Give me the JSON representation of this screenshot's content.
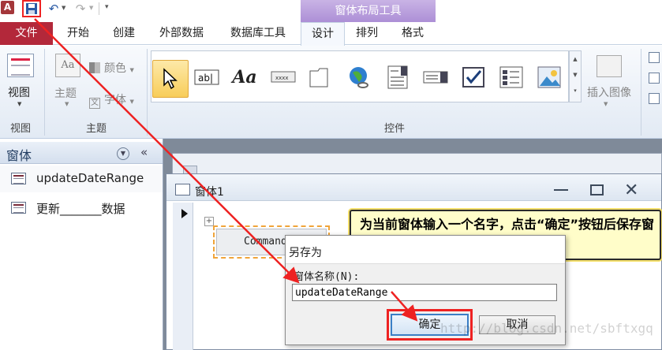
{
  "qat": {
    "app_icon": "A",
    "save_icon": "save-icon",
    "undo_icon": "undo-icon",
    "redo_icon": "redo-icon"
  },
  "context_tab_header": "窗体布局工具",
  "tabs": {
    "file": "文件",
    "items": [
      "开始",
      "创建",
      "外部数据",
      "数据库工具"
    ],
    "context": [
      "设计",
      "排列",
      "格式"
    ]
  },
  "ribbon": {
    "view": {
      "label": "视图",
      "group": "视图"
    },
    "theme": {
      "label": "主题",
      "colors": "颜色",
      "fonts": "字体",
      "group": "主题"
    },
    "controls": {
      "group": "控件",
      "icons": [
        "select-pointer-icon",
        "textbox-icon",
        "label-icon",
        "button-icon",
        "tab-control-icon",
        "hyperlink-icon",
        "combobox-icon",
        "listbox-icon",
        "checkbox-icon",
        "option-group-icon",
        "image-icon"
      ]
    },
    "insert_image": "插入图像"
  },
  "nav": {
    "title": "窗体",
    "items": [
      {
        "label": "updateDateRange"
      },
      {
        "label": "更新_______数据"
      }
    ]
  },
  "form": {
    "title": "窗体1",
    "command_label": "Command"
  },
  "dialog": {
    "title": "另存为",
    "prompt": "窗体名称(N):",
    "input_value": "updateDateRange",
    "ok": "确定",
    "cancel": "取消"
  },
  "callout": "为当前窗体输入一个名字，点击“确定”按钮后保存窗体",
  "watermark": "http://blog.csdn.net/sbftxgq",
  "colors": {
    "file_tab": "#b3283a",
    "context_header": "#ad8fd6",
    "highlight": "#e22222",
    "callout_bg": "#fffdc9"
  }
}
